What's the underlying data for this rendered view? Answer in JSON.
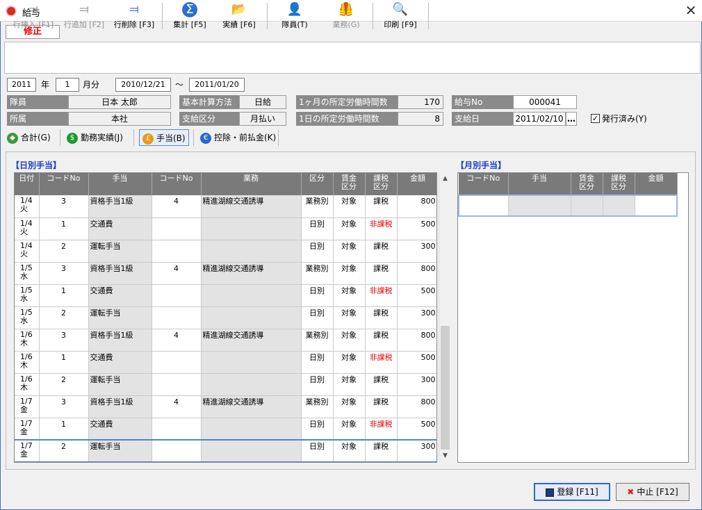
{
  "window": {
    "title": "給与",
    "close_glyph": "✕"
  },
  "mode_badge": "修正",
  "toolbar": [
    {
      "label": "行挿入 [F1]",
      "icon": "row-insert-icon",
      "glyph": "⫤",
      "enabled": false
    },
    {
      "label": "行追加 [F2]",
      "icon": "row-add-icon",
      "glyph": "⫤",
      "enabled": false
    },
    {
      "label": "行削除 [F3]",
      "icon": "row-delete-icon",
      "glyph": "⫤",
      "enabled": true
    },
    {
      "label": "集計 [F5]",
      "icon": "sigma-icon",
      "glyph": "Σ",
      "enabled": true
    },
    {
      "label": "実績 [F6]",
      "icon": "folder-open-icon",
      "glyph": "📂",
      "enabled": true
    },
    {
      "label": "隊員(T)",
      "icon": "person-icon",
      "glyph": "👤",
      "enabled": true
    },
    {
      "label": "業務(G)",
      "icon": "vest-icon",
      "glyph": "🦺",
      "enabled": false
    },
    {
      "label": "印刷 [F9]",
      "icon": "print-preview-icon",
      "glyph": "🔍",
      "enabled": true
    }
  ],
  "period": {
    "year": "2011",
    "year_unit": "年",
    "month": "1",
    "month_unit": "月分",
    "from": "2010/12/21",
    "tilde": "～",
    "to": "2011/01/20"
  },
  "info": {
    "member_label": "隊員",
    "member_value": "日本 太郎",
    "dept_label": "所属",
    "dept_value": "本社",
    "calc_label": "基本計算方法",
    "calc_value": "日給",
    "pay_type_label": "支給区分",
    "pay_type_value": "月払い",
    "monthly_hours_label": "1ヶ月の所定労働時間数",
    "monthly_hours_value": "170",
    "daily_hours_label": "1日の所定労働時間数",
    "daily_hours_value": "8",
    "pay_no_label": "給与No",
    "pay_no_value": "000041",
    "pay_date_label": "支給日",
    "pay_date_value": "2011/02/10",
    "ellipsis": "…",
    "issued_label": "発行済み(Y)",
    "issued_checked": true
  },
  "tabs": [
    {
      "label": "合計(G)",
      "color": "#3a9a3a",
      "glyph": "◆"
    },
    {
      "label": "勤務実績(J)",
      "color": "#1d9a2e",
      "glyph": "$"
    },
    {
      "label": "手当(B)",
      "color": "#e89a1a",
      "glyph": "£",
      "active": true
    },
    {
      "label": "控除・前払金(K)",
      "color": "#2a6ad0",
      "glyph": "€"
    }
  ],
  "daily": {
    "title": "【日別手当】",
    "columns": [
      "日付",
      "コードNo",
      "手当",
      "コードNo",
      "業務",
      "区分",
      "賃金区分",
      "課税区分",
      "金額"
    ],
    "rows": [
      {
        "date": "1/4",
        "dow": "火",
        "code": "3",
        "allow": "資格手当1級",
        "code2": "4",
        "job": "精進湖線交通誘導",
        "kubun": "業務別",
        "wage": "対象",
        "tax": "課税",
        "amount": "800"
      },
      {
        "date": "1/4",
        "dow": "火",
        "code": "1",
        "allow": "交通費",
        "code2": "",
        "job": "",
        "kubun": "日別",
        "wage": "対象",
        "tax": "非課税",
        "amount": "500"
      },
      {
        "date": "1/4",
        "dow": "火",
        "code": "2",
        "allow": "運転手当",
        "code2": "",
        "job": "",
        "kubun": "日別",
        "wage": "対象",
        "tax": "課税",
        "amount": "300"
      },
      {
        "date": "1/5",
        "dow": "水",
        "code": "3",
        "allow": "資格手当1級",
        "code2": "4",
        "job": "精進湖線交通誘導",
        "kubun": "業務別",
        "wage": "対象",
        "tax": "課税",
        "amount": "800"
      },
      {
        "date": "1/5",
        "dow": "水",
        "code": "1",
        "allow": "交通費",
        "code2": "",
        "job": "",
        "kubun": "日別",
        "wage": "対象",
        "tax": "非課税",
        "amount": "500"
      },
      {
        "date": "1/5",
        "dow": "水",
        "code": "2",
        "allow": "運転手当",
        "code2": "",
        "job": "",
        "kubun": "日別",
        "wage": "対象",
        "tax": "課税",
        "amount": "300"
      },
      {
        "date": "1/6",
        "dow": "木",
        "code": "3",
        "allow": "資格手当1級",
        "code2": "4",
        "job": "精進湖線交通誘導",
        "kubun": "業務別",
        "wage": "対象",
        "tax": "課税",
        "amount": "800"
      },
      {
        "date": "1/6",
        "dow": "木",
        "code": "1",
        "allow": "交通費",
        "code2": "",
        "job": "",
        "kubun": "日別",
        "wage": "対象",
        "tax": "非課税",
        "amount": "500"
      },
      {
        "date": "1/6",
        "dow": "木",
        "code": "2",
        "allow": "運転手当",
        "code2": "",
        "job": "",
        "kubun": "日別",
        "wage": "対象",
        "tax": "課税",
        "amount": "300"
      },
      {
        "date": "1/7",
        "dow": "金",
        "code": "3",
        "allow": "資格手当1級",
        "code2": "4",
        "job": "精進湖線交通誘導",
        "kubun": "業務別",
        "wage": "対象",
        "tax": "課税",
        "amount": "800"
      },
      {
        "date": "1/7",
        "dow": "金",
        "code": "1",
        "allow": "交通費",
        "code2": "",
        "job": "",
        "kubun": "日別",
        "wage": "対象",
        "tax": "非課税",
        "amount": "500"
      },
      {
        "date": "1/7",
        "dow": "金",
        "code": "2",
        "allow": "運転手当",
        "code2": "",
        "job": "",
        "kubun": "日別",
        "wage": "対象",
        "tax": "課税",
        "amount": "300"
      }
    ]
  },
  "monthly": {
    "title": "【月別手当】",
    "columns": [
      "コードNo",
      "手当",
      "賃金区分",
      "課税区分",
      "金額"
    ]
  },
  "buttons": {
    "save": "登録 [F11]",
    "save_icon": "floppy-disk-icon",
    "cancel": "中止 [F12]",
    "cancel_icon": "red-x-icon"
  },
  "colors": {
    "nontax_red": "#e00000",
    "accent_blue": "#1a3ec8",
    "selection_blue": "#4f84d0"
  }
}
